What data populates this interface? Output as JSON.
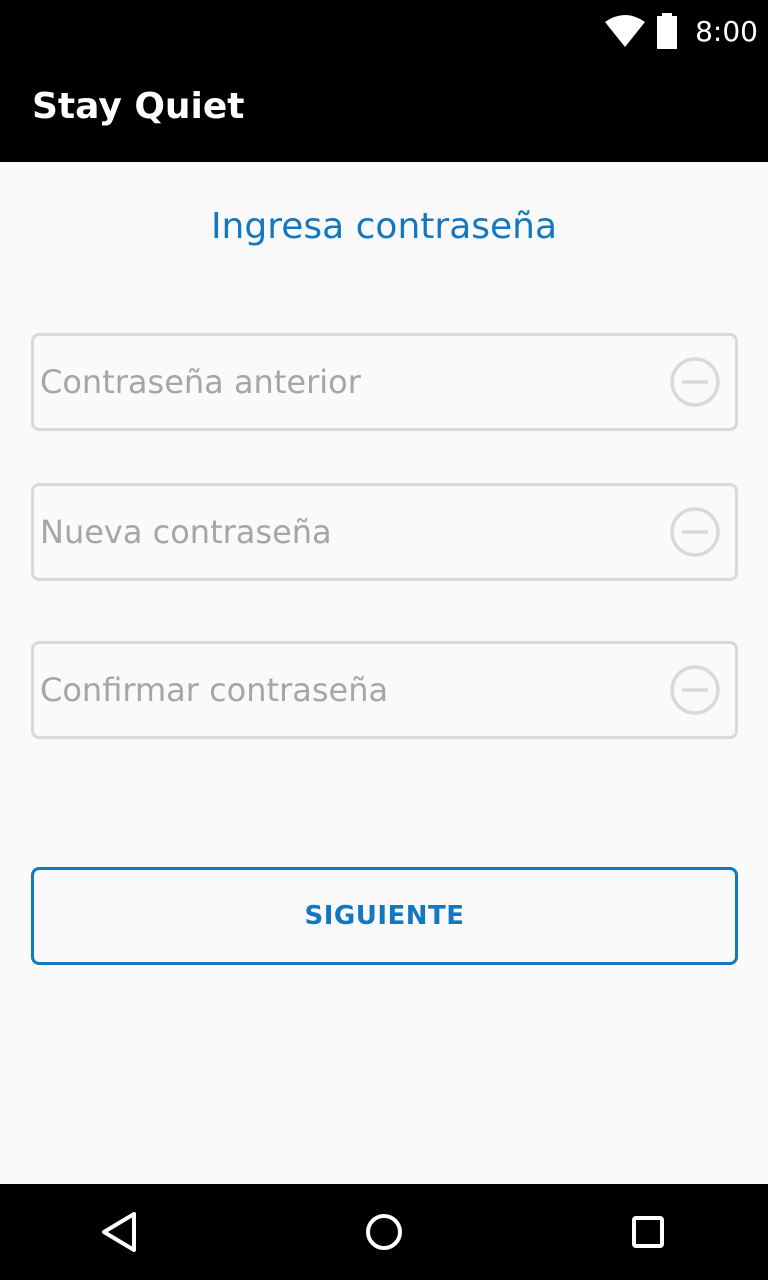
{
  "status_bar": {
    "time": "8:00",
    "icons": [
      "wifi-icon",
      "battery-icon"
    ]
  },
  "app_bar": {
    "title": "Stay Quiet"
  },
  "main": {
    "heading": "Ingresa contraseña",
    "fields": [
      {
        "placeholder": "Contraseña anterior",
        "value": "",
        "icon": "clear-icon"
      },
      {
        "placeholder": "Nueva contraseña",
        "value": "",
        "icon": "clear-icon"
      },
      {
        "placeholder": "Confirmar contraseña",
        "value": "",
        "icon": "clear-icon"
      }
    ],
    "next_button_label": "SIGUIENTE"
  },
  "nav_bar": {
    "buttons": [
      "back-icon",
      "home-icon",
      "recents-icon"
    ]
  },
  "colors": {
    "accent": "#1477c1",
    "field_border": "#d9d9d9",
    "placeholder": "#a6a6a6",
    "background": "#fafafa",
    "bars": "#000000"
  }
}
